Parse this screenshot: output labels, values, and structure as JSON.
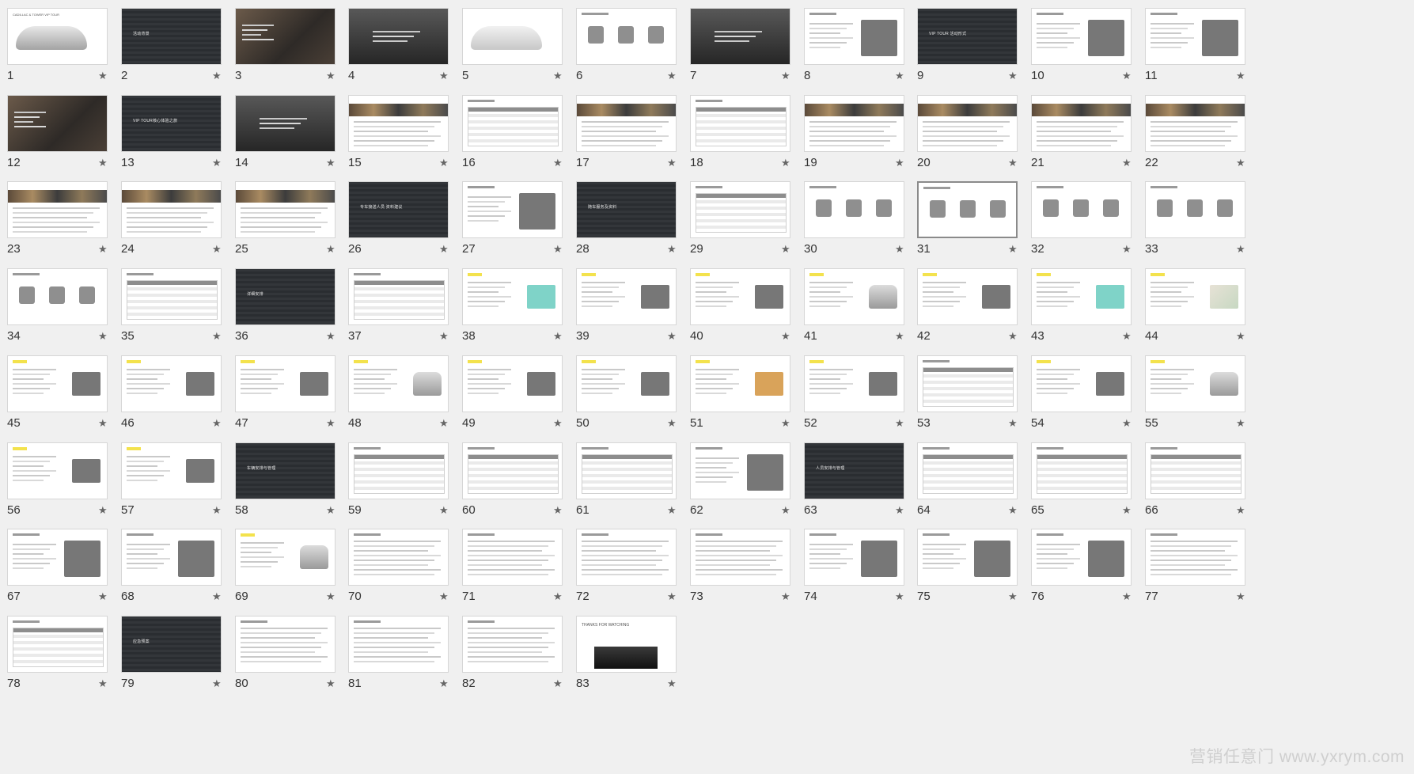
{
  "view": "Slide Sorter",
  "selected_slide": 31,
  "star_glyph": "★",
  "slides": [
    {
      "n": "1",
      "t": "cover"
    },
    {
      "n": "2",
      "t": "dark",
      "label": "活动背景"
    },
    {
      "n": "3",
      "t": "photo"
    },
    {
      "n": "4",
      "t": "photo2"
    },
    {
      "n": "5",
      "t": "car"
    },
    {
      "n": "6",
      "t": "imgs"
    },
    {
      "n": "7",
      "t": "photo2"
    },
    {
      "n": "8",
      "t": "img"
    },
    {
      "n": "9",
      "t": "dark",
      "label": "VIP TOUR 活动形式"
    },
    {
      "n": "10",
      "t": "img"
    },
    {
      "n": "11",
      "t": "img"
    },
    {
      "n": "12",
      "t": "photo"
    },
    {
      "n": "13",
      "t": "dark",
      "label": "VIP TOUR核心体验之旅"
    },
    {
      "n": "14",
      "t": "photo2"
    },
    {
      "n": "15",
      "t": "strip"
    },
    {
      "n": "16",
      "t": "table"
    },
    {
      "n": "17",
      "t": "strip"
    },
    {
      "n": "18",
      "t": "table"
    },
    {
      "n": "19",
      "t": "strip"
    },
    {
      "n": "20",
      "t": "strip"
    },
    {
      "n": "21",
      "t": "strip"
    },
    {
      "n": "22",
      "t": "strip"
    },
    {
      "n": "23",
      "t": "strip"
    },
    {
      "n": "24",
      "t": "strip"
    },
    {
      "n": "25",
      "t": "strip"
    },
    {
      "n": "26",
      "t": "dark",
      "label": "专车接送人员 资料建议"
    },
    {
      "n": "27",
      "t": "img"
    },
    {
      "n": "28",
      "t": "dark",
      "label": "随车服务及资料"
    },
    {
      "n": "29",
      "t": "table"
    },
    {
      "n": "30",
      "t": "icons"
    },
    {
      "n": "31",
      "t": "icons"
    },
    {
      "n": "32",
      "t": "icons"
    },
    {
      "n": "33",
      "t": "icons"
    },
    {
      "n": "34",
      "t": "icons"
    },
    {
      "n": "35",
      "t": "table"
    },
    {
      "n": "36",
      "t": "dark",
      "label": "详细安排"
    },
    {
      "n": "37",
      "t": "table"
    },
    {
      "n": "38",
      "t": "teal"
    },
    {
      "n": "39",
      "t": "hlimg"
    },
    {
      "n": "40",
      "t": "hlimg"
    },
    {
      "n": "41",
      "t": "hlcar"
    },
    {
      "n": "42",
      "t": "hlimg"
    },
    {
      "n": "43",
      "t": "teal"
    },
    {
      "n": "44",
      "t": "map"
    },
    {
      "n": "45",
      "t": "hlimg"
    },
    {
      "n": "46",
      "t": "hlimg"
    },
    {
      "n": "47",
      "t": "hlimg"
    },
    {
      "n": "48",
      "t": "hlcar"
    },
    {
      "n": "49",
      "t": "hlimg"
    },
    {
      "n": "50",
      "t": "hlimg"
    },
    {
      "n": "51",
      "t": "box"
    },
    {
      "n": "52",
      "t": "hlimg"
    },
    {
      "n": "53",
      "t": "table"
    },
    {
      "n": "54",
      "t": "hlimg"
    },
    {
      "n": "55",
      "t": "hlcar"
    },
    {
      "n": "56",
      "t": "hlimg"
    },
    {
      "n": "57",
      "t": "hlimg"
    },
    {
      "n": "58",
      "t": "dark",
      "label": "车辆安排与管理"
    },
    {
      "n": "59",
      "t": "table"
    },
    {
      "n": "60",
      "t": "table"
    },
    {
      "n": "61",
      "t": "table"
    },
    {
      "n": "62",
      "t": "img"
    },
    {
      "n": "63",
      "t": "dark",
      "label": "人员安排与管理"
    },
    {
      "n": "64",
      "t": "table"
    },
    {
      "n": "65",
      "t": "table"
    },
    {
      "n": "66",
      "t": "table"
    },
    {
      "n": "67",
      "t": "img"
    },
    {
      "n": "68",
      "t": "img"
    },
    {
      "n": "69",
      "t": "hlcar"
    },
    {
      "n": "70",
      "t": "text"
    },
    {
      "n": "71",
      "t": "text"
    },
    {
      "n": "72",
      "t": "text"
    },
    {
      "n": "73",
      "t": "text"
    },
    {
      "n": "74",
      "t": "img"
    },
    {
      "n": "75",
      "t": "img"
    },
    {
      "n": "76",
      "t": "img"
    },
    {
      "n": "77",
      "t": "text"
    },
    {
      "n": "78",
      "t": "table"
    },
    {
      "n": "79",
      "t": "dark",
      "label": "应急预案"
    },
    {
      "n": "80",
      "t": "text"
    },
    {
      "n": "81",
      "t": "text"
    },
    {
      "n": "82",
      "t": "text"
    },
    {
      "n": "83",
      "t": "end"
    }
  ],
  "cover_title": "CADILLAC & TOWER VIP TOUR",
  "end_title": "THANKS FOR WATCHING",
  "watermark": "营销任意门 www.yxrym.com"
}
